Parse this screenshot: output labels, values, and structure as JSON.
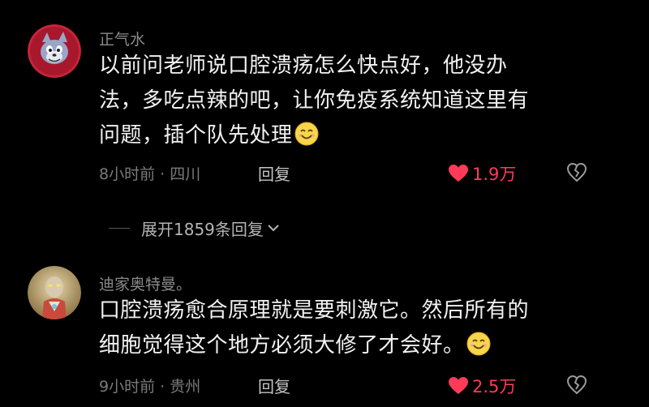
{
  "comments": [
    {
      "username": "正气水",
      "content_lines": [
        "以前问老师说口腔溃疡怎么快点好，他没办",
        "法，多吃点辣的吧，让你免疫系统知道这里有",
        "问题，插个队先处理"
      ],
      "emoji": "smile-emoji",
      "time": "8小时前",
      "location": "四川",
      "meta": "8小时前 · 四川",
      "reply_label": "回复",
      "like_count": "1.9万",
      "avatar": "cartoon-cat-avatar"
    },
    {
      "username": "迪家奥特曼。",
      "content_lines": [
        "口腔溃疡愈合原理就是要刺激它。然后所有的",
        "细胞觉得这个地方必须大修了才会好。"
      ],
      "emoji": "smile-emoji",
      "time": "9小时前",
      "location": "贵州",
      "meta": "9小时前 · 贵州",
      "reply_label": "回复",
      "like_count": "2.5万",
      "avatar": "ultraman-figure-avatar"
    }
  ],
  "expand_replies": {
    "label": "展开1859条回复",
    "icon": "chevron-down-icon"
  },
  "colors": {
    "background": "#000000",
    "text": "#f2f2f2",
    "muted": "#7a7a7a",
    "like": "#ff3b57"
  }
}
